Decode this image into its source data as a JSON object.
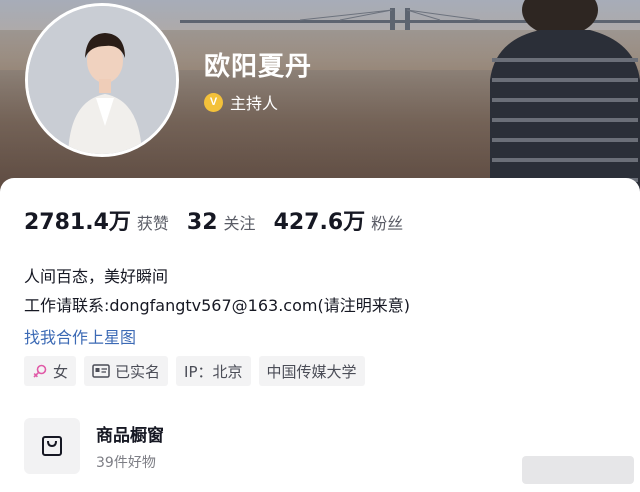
{
  "profile": {
    "name": "欧阳夏丹",
    "verify_badge": "V",
    "verify_label": "主持人"
  },
  "stats": [
    {
      "value": "2781.4万",
      "label": "获赞"
    },
    {
      "value": "32",
      "label": "关注"
    },
    {
      "value": "427.6万",
      "label": "粉丝"
    }
  ],
  "bio": {
    "line1": "人间百态，美好瞬间",
    "line2": "工作请联系:dongfangtv567@163.com(请注明来意)"
  },
  "star_link": "找我合作上星图",
  "tags": [
    {
      "icon": "female-icon",
      "label": "女"
    },
    {
      "icon": "id-card-icon",
      "label": "已实名"
    },
    {
      "icon": "",
      "label": "IP：北京"
    },
    {
      "icon": "",
      "label": "中国传媒大学"
    }
  ],
  "shop": {
    "icon": "shopping-bag-icon",
    "title": "商品橱窗",
    "subtitle": "39件好物"
  },
  "colors": {
    "link": "#3c6ab5",
    "badge": "#f3c13a",
    "text_primary": "#161823",
    "text_secondary": "#5a5c66"
  }
}
